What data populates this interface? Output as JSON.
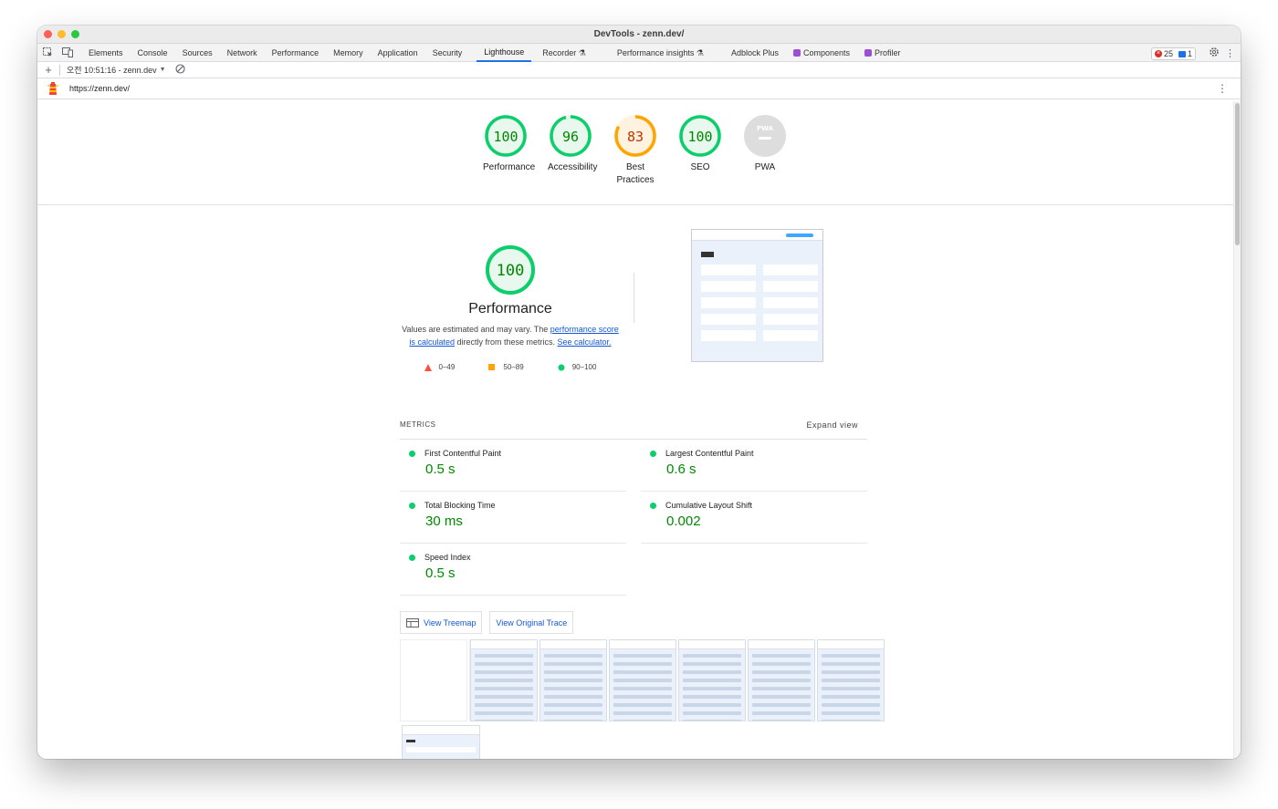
{
  "window": {
    "title": "DevTools - zenn.dev/"
  },
  "tabs": [
    {
      "label": "Elements"
    },
    {
      "label": "Console"
    },
    {
      "label": "Sources"
    },
    {
      "label": "Network"
    },
    {
      "label": "Performance"
    },
    {
      "label": "Memory"
    },
    {
      "label": "Application"
    },
    {
      "label": "Security"
    },
    {
      "label": "Lighthouse"
    },
    {
      "label": "Recorder ⚗"
    },
    {
      "label": "Performance insights ⚗"
    },
    {
      "label": "Adblock Plus"
    },
    {
      "label": "Components"
    },
    {
      "label": "Profiler"
    }
  ],
  "counts": {
    "errors": "25",
    "messages": "1"
  },
  "report_selector": "오전 10:51:16 - zenn.dev",
  "url": "https://zenn.dev/",
  "gauges": [
    {
      "score": "100",
      "label": "Performance",
      "value": 1.0,
      "color": "#0cce6b"
    },
    {
      "score": "96",
      "label": "Accessibility",
      "value": 0.96,
      "color": "#0cce6b"
    },
    {
      "score": "83",
      "label": "Best Practices",
      "value": 0.83,
      "color": "#ffa400"
    },
    {
      "score": "100",
      "label": "SEO",
      "value": 1.0,
      "color": "#0cce6b"
    },
    {
      "score": "",
      "label": "PWA",
      "value": 0,
      "color": "#dddddd"
    }
  ],
  "performance": {
    "score": "100",
    "title": "Performance",
    "desc_prefix": "Values are estimated and may vary. The ",
    "desc_link1": "performance score is calculated",
    "desc_middle": " directly from these metrics. ",
    "desc_link2": "See calculator.",
    "legend": [
      {
        "range": "0–49",
        "color": "#ff4e42"
      },
      {
        "range": "50–89",
        "color": "#ffa400"
      },
      {
        "range": "90–100",
        "color": "#0cce6b"
      }
    ]
  },
  "metrics": {
    "heading": "METRICS",
    "expand": "Expand view",
    "items": [
      {
        "name": "First Contentful Paint",
        "value": "0.5 s"
      },
      {
        "name": "Largest Contentful Paint",
        "value": "0.6 s"
      },
      {
        "name": "Total Blocking Time",
        "value": "30 ms"
      },
      {
        "name": "Cumulative Layout Shift",
        "value": "0.002"
      },
      {
        "name": "Speed Index",
        "value": "0.5 s"
      }
    ]
  },
  "buttons": {
    "treemap": "View Treemap",
    "trace": "View Original Trace"
  }
}
